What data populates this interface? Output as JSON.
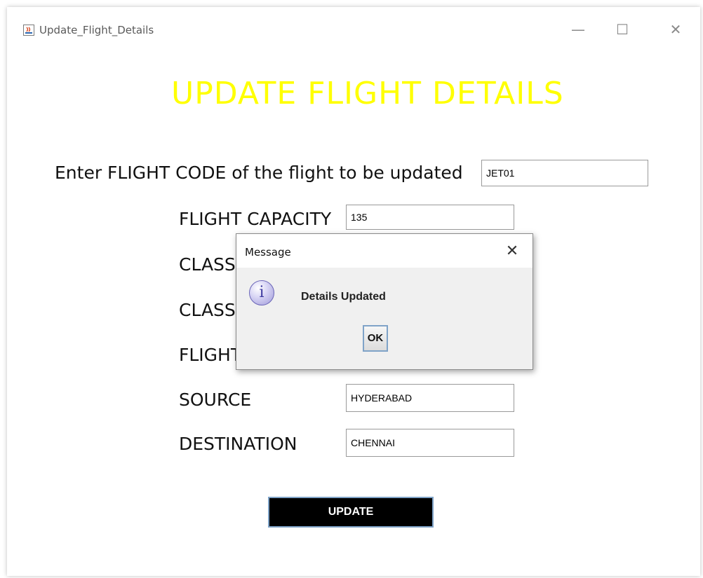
{
  "window": {
    "title": "Update_Flight_Details",
    "minimize_glyph": "—",
    "maximize_glyph": "☐",
    "close_glyph": "✕"
  },
  "heading": "UPDATE FLIGHT DETAILS",
  "flight_code": {
    "label": "Enter FLIGHT CODE of the flight to be updated",
    "value": "JET01"
  },
  "fields": {
    "capacity": {
      "label": "FLIGHT CAPACITY",
      "value": "135"
    },
    "class1": {
      "label": "CLASS",
      "value": ""
    },
    "class2": {
      "label": "CLASS",
      "value": ""
    },
    "flight": {
      "label": "FLIGHT",
      "value": ""
    },
    "source": {
      "label": "SOURCE",
      "value": "HYDERABAD"
    },
    "destination": {
      "label": "DESTINATION",
      "value": "CHENNAI"
    }
  },
  "update_button": "UPDATE",
  "dialog": {
    "title": "Message",
    "close_glyph": "✕",
    "icon": "info-icon",
    "icon_glyph": "i",
    "message": "Details Updated",
    "ok_label": "OK"
  },
  "colors": {
    "heading": "#ffff00",
    "update_button_bg": "#000000",
    "dialog_bg": "#f0f0f0"
  }
}
